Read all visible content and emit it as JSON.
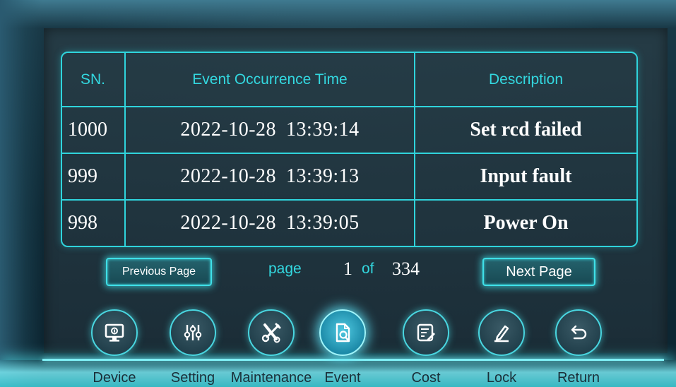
{
  "table": {
    "headers": {
      "sn": "SN.",
      "time": "Event Occurrence Time",
      "description": "Description"
    },
    "rows": [
      {
        "sn": "1000",
        "date": "2022-10-28",
        "time": "13:39:14",
        "description": "Set rcd failed"
      },
      {
        "sn": "999",
        "date": "2022-10-28",
        "time": "13:39:13",
        "description": "Input fault"
      },
      {
        "sn": "998",
        "date": "2022-10-28",
        "time": "13:39:05",
        "description": "Power On"
      }
    ]
  },
  "pagination": {
    "previous_label": "Previous Page",
    "next_label": "Next Page",
    "page_label": "page",
    "current_page": "1",
    "of_label": "of",
    "total_pages": "334"
  },
  "nav": {
    "items": [
      {
        "label": "Device",
        "icon": "monitor-icon",
        "active": false
      },
      {
        "label": "Setting",
        "icon": "sliders-icon",
        "active": false
      },
      {
        "label": "Maintenance",
        "icon": "tools-icon",
        "active": false
      },
      {
        "label": "Event",
        "icon": "document-search-icon",
        "active": true
      },
      {
        "label": "Cost",
        "icon": "list-edit-icon",
        "active": false
      },
      {
        "label": "Lock",
        "icon": "pen-icon",
        "active": false
      },
      {
        "label": "Return",
        "icon": "return-arrow-icon",
        "active": false
      }
    ]
  },
  "colors": {
    "accent": "#2fd4dc",
    "text": "#ffffff",
    "background": "#1c2e38"
  }
}
